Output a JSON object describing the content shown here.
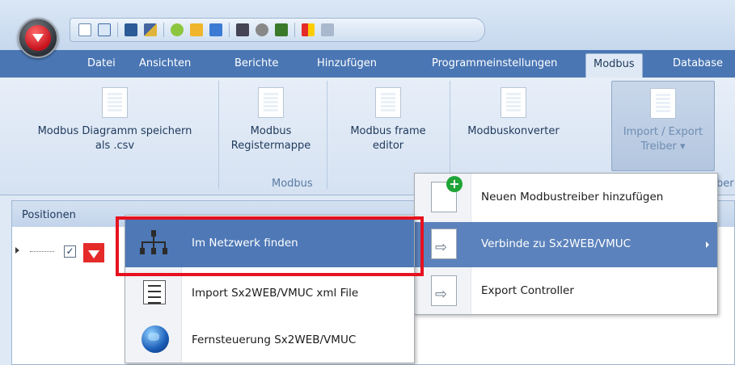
{
  "quick_access": {
    "icons": [
      "new-document-icon",
      "open-document-icon",
      "save-icon",
      "edit-icon",
      "refresh-icon",
      "import-icon",
      "export-icon",
      "network-icon",
      "wireless-icon",
      "tree-icon",
      "color-icon",
      "monitor-icon"
    ]
  },
  "tabs": [
    {
      "label": "Datei"
    },
    {
      "label": "Ansichten"
    },
    {
      "label": "Berichte"
    },
    {
      "label": "Hinzufügen"
    },
    {
      "label": "Programmeinstellungen"
    },
    {
      "label": "Modbus",
      "active": true
    },
    {
      "label": "Database"
    }
  ],
  "ribbon": {
    "buttons": [
      {
        "line1": "Modbus Diagramm speichern",
        "line2": "als .csv"
      },
      {
        "line1": "Modbus",
        "line2": "Registermappe"
      },
      {
        "line1": "Modbus frame",
        "line2": "editor"
      },
      {
        "line1": "Modbuskonverter",
        "line2": ""
      },
      {
        "line1": "Import / Export",
        "line2": "Treiber ▾"
      }
    ],
    "group_label": "Modbus",
    "group_label_right_fragment": "ber"
  },
  "panel": {
    "title": "Positionen"
  },
  "menu_right": {
    "items": [
      {
        "label": "Neuen Modbustreiber hinzufügen",
        "icon": "add-document-icon"
      },
      {
        "label": "Verbinde zu Sx2WEB/VMUC",
        "icon": "connect-document-icon",
        "has_submenu": true
      },
      {
        "label": "Export Controller",
        "icon": "export-document-icon"
      }
    ]
  },
  "menu_left": {
    "items": [
      {
        "label": "Im Netzwerk finden",
        "icon": "network-icon"
      },
      {
        "label": "Import Sx2WEB/VMUC xml File",
        "icon": "list-file-icon"
      },
      {
        "label": "Fernsteuerung Sx2WEB/VMUC",
        "icon": "globe-icon"
      }
    ]
  },
  "colors": {
    "tab_bar": "#4a76b4",
    "highlight_outline": "#e6121f",
    "menu_hover": "#5b82bc"
  }
}
